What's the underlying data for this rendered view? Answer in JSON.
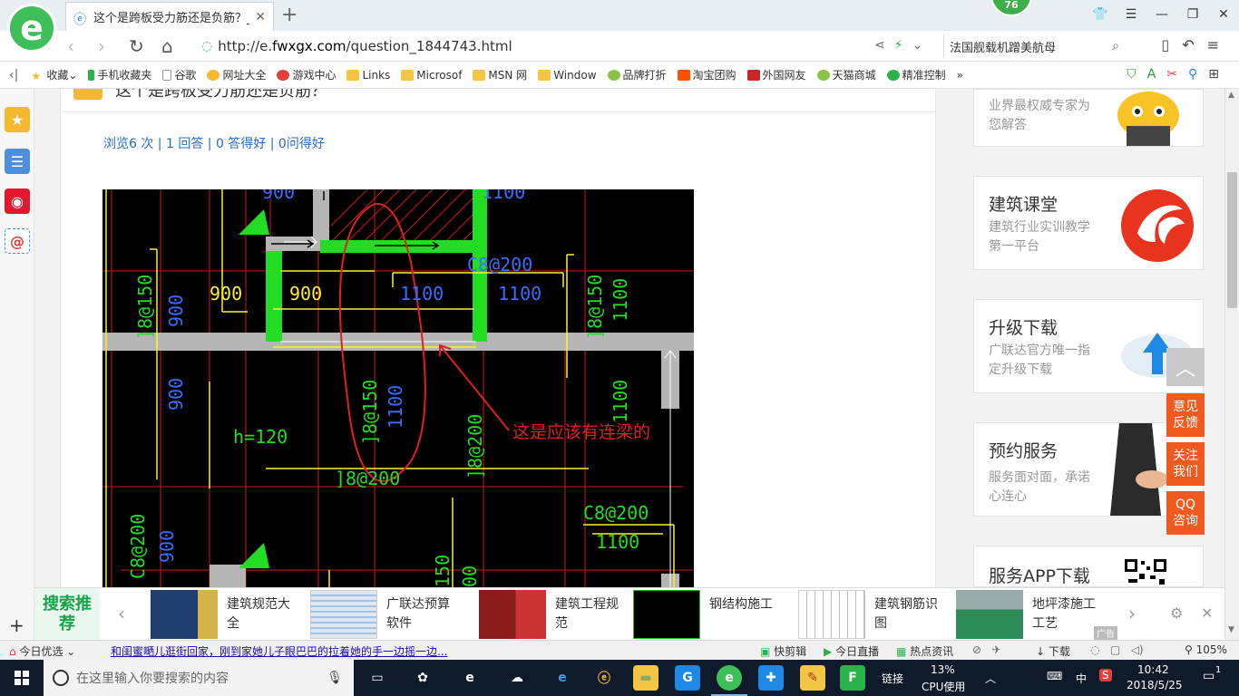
{
  "browser": {
    "tab_title": "这个是跨板受力筋还是负筋？_广",
    "badge_count": "76",
    "url_prefix": "http://e.",
    "url_host": "fwxgx.com",
    "url_path": "/question_1844743.html",
    "search_text": "法国舰载机蹭美航母"
  },
  "bookmarks": [
    "收藏",
    "手机收藏夹",
    "谷歌",
    "网址大全",
    "游戏中心",
    "Links",
    "Microsof",
    "MSN 网",
    "Window",
    "品牌打折",
    "淘宝团购",
    "外国网友",
    "天猫商城",
    "精准控制"
  ],
  "article": {
    "title_partial": "这个是跨板受力筋还是负筋？",
    "stats": "浏览6 次 | 1 回答 | 0 答得好 | 0问得好"
  },
  "drawing": {
    "labels": [
      "900",
      "900",
      "1100",
      "1100",
      "C8@200",
      "C8@200",
      "C8@200",
      "]8@150",
      "]8@150",
      "]8@150",
      "900",
      "900",
      "900",
      "1100",
      "1100",
      "1100",
      "1100",
      "h=120",
      "]8@200",
      "]8@200",
      "1100",
      "150",
      "00",
      "900"
    ],
    "annotation": "这是应该有连梁的"
  },
  "sidebar_cards": [
    {
      "title": "",
      "desc": "业界最权威专家为您解答"
    },
    {
      "title": "建筑课堂",
      "desc": "建筑行业实训教学第一平台"
    },
    {
      "title": "升级下载",
      "desc": "广联达官方唯一指定升级下载"
    },
    {
      "title": "预约服务",
      "desc": "服务面对面，承诺心连心"
    },
    {
      "title": "服务APP下载",
      "desc": ""
    }
  ],
  "float_buttons": [
    "意见反馈",
    "关注我们",
    "QQ咨询"
  ],
  "recommend": {
    "label": "搜索推荐",
    "items": [
      "建筑规范大全",
      "广联达预算软件",
      "建筑工程规范",
      "钢结构施工",
      "建筑钢筋识图",
      "地坪漆施工工艺"
    ],
    "ad": "广告"
  },
  "statusbar": {
    "today": "今日优选",
    "news": "和闺蜜嗮儿逛街回家，刚到家她儿子眼巴巴的拉着她的手一边摇一边...",
    "quick_clip": "快剪辑",
    "live": "今日直播",
    "hot": "热点资讯",
    "download": "下载",
    "zoom": "105%"
  },
  "taskbar": {
    "search_placeholder": "在这里输入你要搜索的内容",
    "link": "链接",
    "cpu": "13%",
    "cpu_label": "CPU使用",
    "lang": "中",
    "time": "10:42",
    "date": "2018/5/25",
    "notify": "1"
  },
  "colors": {
    "brand_green": "#3fbf5a",
    "link_blue": "#2a6cc4",
    "accent_orange": "#f05a1e",
    "cad_green": "#22dd22",
    "cad_yellow": "#ffee33",
    "cad_red": "#e02020",
    "cad_blue": "#3a6cff"
  }
}
